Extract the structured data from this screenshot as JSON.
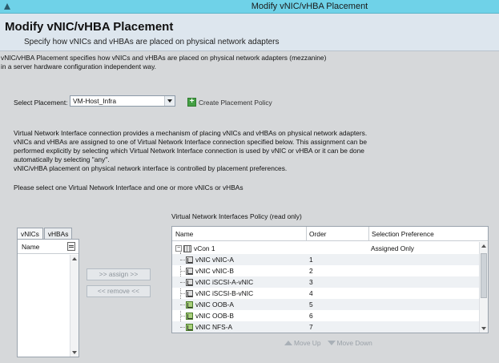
{
  "window": {
    "title": "Modify vNIC/vHBA Placement"
  },
  "header": {
    "title": "Modify vNIC/vHBA Placement",
    "subtitle": "Specify how vNICs and vHBAs are placed on physical network adapters"
  },
  "description": "vNIC/vHBA Placement specifies how vNICs and vHBAs are placed on physical network adapters (mezzanine)\nin a server hardware configuration independent way.",
  "placement": {
    "label": "Select Placement:",
    "value": "VM-Host_Infra",
    "create_label": "Create Placement Policy"
  },
  "info": "Virtual Network Interface connection provides a mechanism of placing vNICs and vHBAs on physical network adapters.\nvNICs and vHBAs are assigned to one of Virtual Network Interface connection specified below. This assignment can be\nperformed explicitly by selecting which Virtual Network Interface connection is used by vNIC or vHBA or it can be done\nautomatically by selecting \"any\".\nvNIC/vHBA placement on physical network interface is controlled by placement preferences.",
  "instruction": "Please select one Virtual Network Interface and one or more vNICs or vHBAs",
  "left_panel": {
    "tabs": [
      "vNICs",
      "vHBAs"
    ],
    "column": "Name"
  },
  "buttons": {
    "assign": ">> assign >>",
    "remove": "<< remove <<"
  },
  "policy": {
    "label": "Virtual Network Interfaces Policy (read only)",
    "columns": [
      "Name",
      "Order",
      "Selection Preference"
    ],
    "vcon": {
      "name": "vCon 1",
      "preference": "Assigned Only"
    },
    "rows": [
      {
        "name": "vNIC vNIC-A",
        "order": "1",
        "icon": "gray"
      },
      {
        "name": "vNIC vNIC-B",
        "order": "2",
        "icon": "gray"
      },
      {
        "name": "vNIC iSCSI-A-vNIC",
        "order": "3",
        "icon": "gray"
      },
      {
        "name": "vNIC iSCSI-B-vNIC",
        "order": "4",
        "icon": "gray"
      },
      {
        "name": "vNIC OOB-A",
        "order": "5",
        "icon": "green"
      },
      {
        "name": "vNIC OOB-B",
        "order": "6",
        "icon": "green"
      },
      {
        "name": "vNIC NFS-A",
        "order": "7",
        "icon": "green"
      }
    ]
  },
  "move": {
    "up": "Move Up",
    "down": "Move Down"
  }
}
